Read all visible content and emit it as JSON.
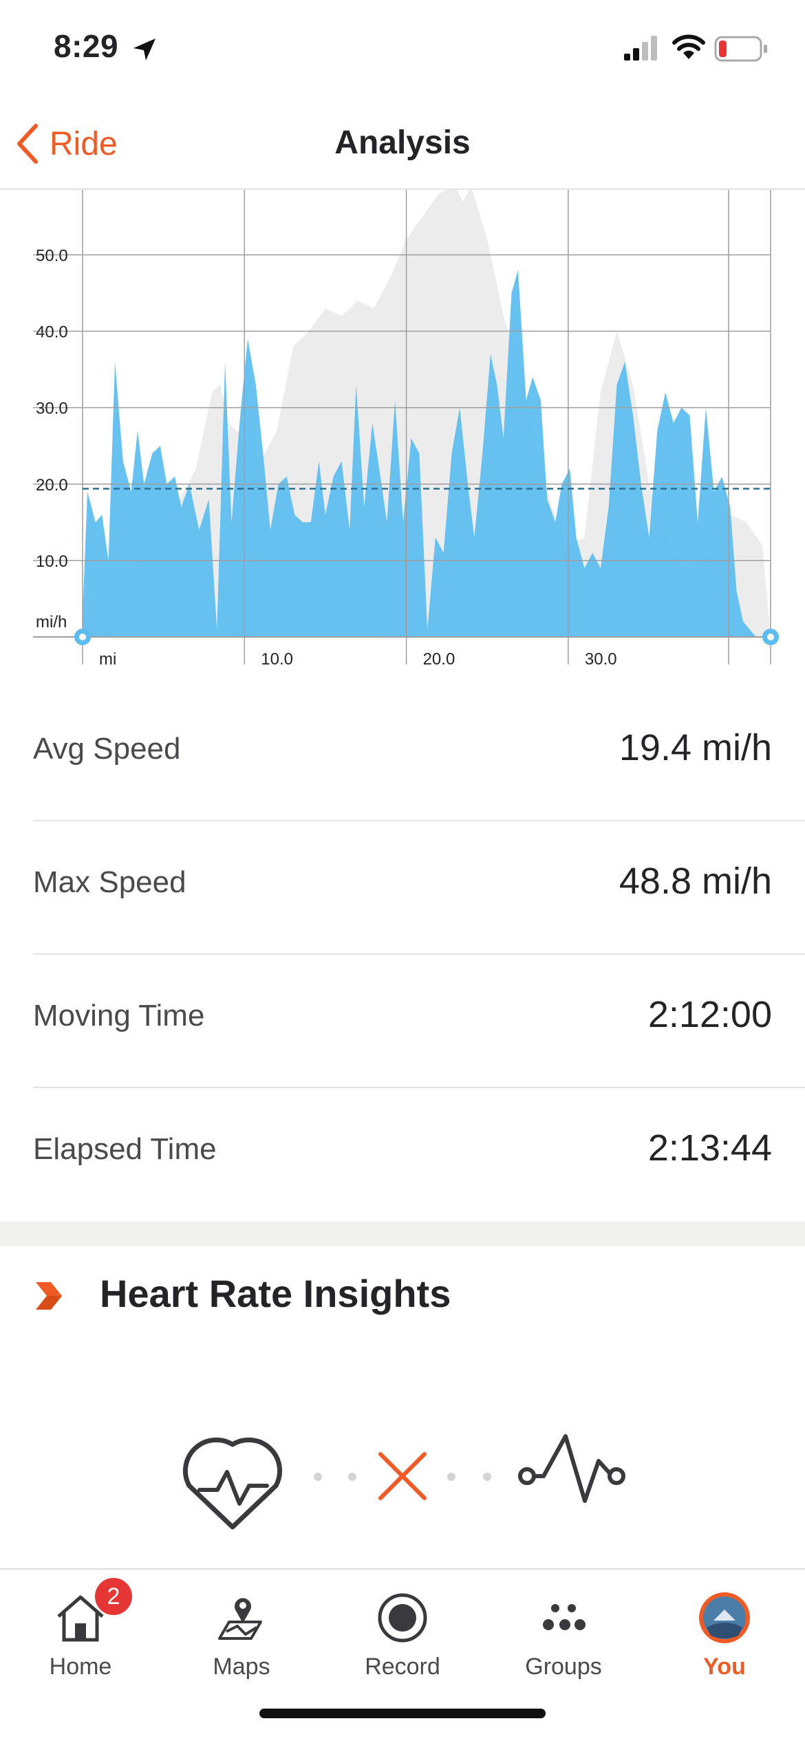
{
  "status_bar": {
    "time": "8:29",
    "icons": [
      "location-arrow-icon",
      "cellular-signal-icon",
      "wifi-icon",
      "battery-low-icon"
    ]
  },
  "header": {
    "back_label": "Ride",
    "title": "Analysis",
    "accent_color": "#f05a24"
  },
  "chart_data": {
    "type": "area",
    "title": "",
    "xlabel": "mi",
    "ylabel": "mi/h",
    "x_ticks": [
      "mi",
      "10.0",
      "20.0",
      "30.0"
    ],
    "y_ticks": [
      "mi/h",
      "10.0",
      "20.0",
      "30.0",
      "40.0",
      "50.0"
    ],
    "xlim": [
      0,
      42.5
    ],
    "ylim": [
      0,
      58.5
    ],
    "average_line": 19.4,
    "grid": true,
    "series": [
      {
        "role": "elevation",
        "color": "#ececec",
        "x": [
          0,
          1,
          3,
          5,
          7,
          8,
          8.5,
          9,
          10,
          11,
          12,
          13,
          14,
          15,
          16,
          17,
          18,
          19,
          20,
          21,
          22,
          23,
          23.5,
          24,
          25,
          26,
          27,
          28,
          29,
          30,
          31,
          32,
          33,
          34,
          35,
          36,
          37,
          38,
          39,
          40,
          41,
          42,
          42.5
        ],
        "values": [
          1,
          6,
          9,
          14,
          22,
          32,
          33,
          28,
          26,
          23,
          27,
          38,
          40,
          43,
          42,
          44,
          43,
          47,
          52,
          55,
          58,
          59,
          57,
          59,
          52,
          42,
          35,
          25,
          17,
          12,
          13,
          32,
          40,
          33,
          20,
          13,
          9,
          9,
          12,
          16,
          15,
          12,
          0
        ]
      },
      {
        "role": "speed",
        "color": "#5bbcf0",
        "x": [
          0,
          0.3,
          0.8,
          1.2,
          1.6,
          2,
          2.5,
          3,
          3.4,
          3.8,
          4.3,
          4.8,
          5.2,
          5.7,
          6.1,
          6.6,
          7.2,
          7.8,
          8.3,
          8.8,
          9.2,
          9.7,
          10.2,
          10.7,
          11.2,
          11.6,
          12.1,
          12.6,
          13.1,
          13.6,
          14.1,
          14.6,
          15,
          15.5,
          16,
          16.5,
          16.9,
          17.4,
          17.9,
          18.4,
          18.8,
          19.3,
          19.8,
          20.3,
          20.8,
          21.3,
          21.8,
          22.3,
          22.8,
          23.3,
          23.8,
          24.2,
          24.7,
          25.2,
          25.6,
          26,
          26.5,
          26.9,
          27.4,
          27.8,
          28.3,
          28.7,
          29.2,
          29.6,
          30.1,
          30.5,
          31,
          31.5,
          32,
          32.5,
          33,
          33.5,
          34,
          34.5,
          35,
          35.5,
          36,
          36.5,
          37,
          37.5,
          38,
          38.5,
          39,
          39.5,
          40,
          40.4,
          40.8,
          41.2,
          41.6,
          42,
          42.5
        ],
        "values": [
          3,
          19,
          15,
          16,
          10,
          36,
          23,
          19,
          27,
          20,
          24,
          25,
          20,
          21,
          17,
          20,
          14,
          18,
          1,
          36,
          15,
          28,
          39,
          33,
          23,
          14,
          20,
          21,
          16,
          15,
          15,
          23,
          16,
          21,
          23,
          14,
          33,
          17,
          28,
          21,
          15,
          31,
          15,
          26,
          24,
          1,
          13,
          11,
          24,
          30,
          20,
          13,
          24,
          37,
          33,
          26,
          45,
          48,
          31,
          34,
          31,
          18,
          15,
          20,
          22,
          13,
          9,
          11,
          9,
          17,
          33,
          36,
          29,
          20,
          13,
          27,
          32,
          28,
          30,
          29,
          15,
          30,
          19,
          21,
          17,
          6,
          2,
          1,
          0,
          0,
          0
        ]
      }
    ]
  },
  "stats": [
    {
      "label": "Avg Speed",
      "value": "19.4 mi/h"
    },
    {
      "label": "Max Speed",
      "value": "48.8 mi/h"
    },
    {
      "label": "Moving Time",
      "value": "2:12:00"
    },
    {
      "label": "Elapsed Time",
      "value": "2:13:44"
    }
  ],
  "heart_rate": {
    "title": "Heart Rate Insights",
    "icons": [
      "heart-pulse-icon",
      "x-icon",
      "zigzag-sensor-icon"
    ]
  },
  "tabs": [
    {
      "label": "Home",
      "icon": "home-icon",
      "badge": "2"
    },
    {
      "label": "Maps",
      "icon": "map-pin-icon"
    },
    {
      "label": "Record",
      "icon": "record-icon"
    },
    {
      "label": "Groups",
      "icon": "groups-icon"
    },
    {
      "label": "You",
      "icon": "avatar",
      "active": true
    }
  ]
}
